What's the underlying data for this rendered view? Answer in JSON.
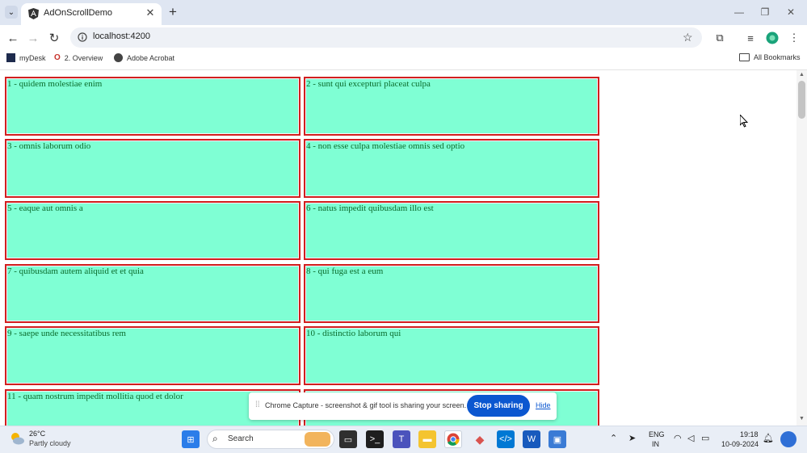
{
  "browser": {
    "tab_title": "AdOnScrollDemo",
    "url": "localhost:4200",
    "bookmarks": [
      {
        "label": "myDesk",
        "icon": "mydesk-icon"
      },
      {
        "label": "2. Overview",
        "icon": "overview-icon"
      },
      {
        "label": "Adobe Acrobat",
        "icon": "acrobat-icon"
      }
    ],
    "all_bookmarks": "All Bookmarks"
  },
  "page": {
    "cards": [
      {
        "text": "1 - quidem molestiae enim"
      },
      {
        "text": "2 - sunt qui excepturi placeat culpa"
      },
      {
        "text": "3 - omnis laborum odio"
      },
      {
        "text": "4 - non esse culpa molestiae omnis sed optio"
      },
      {
        "text": "5 - eaque aut omnis a"
      },
      {
        "text": "6 - natus impedit quibusdam illo est"
      },
      {
        "text": "7 - quibusdam autem aliquid et et quia"
      },
      {
        "text": "8 - qui fuga est a eum"
      },
      {
        "text": "9 - saepe unde necessitatibus rem"
      },
      {
        "text": "10 - distinctio laborum qui"
      },
      {
        "text": "11 - quam nostrum impedit mollitia quod et dolor"
      },
      {
        "text": ""
      }
    ],
    "card_fill": "#7fffd4",
    "card_border": "#d11f1f"
  },
  "share_banner": {
    "message": "Chrome Capture - screenshot & gif tool is sharing your screen.",
    "stop_label": "Stop sharing",
    "hide_label": "Hide"
  },
  "taskbar": {
    "weather_temp": "26°C",
    "weather_desc": "Partly cloudy",
    "search_label": "Search",
    "lang_top": "ENG",
    "lang_bottom": "IN",
    "time": "19:18",
    "date": "10-09-2024"
  }
}
